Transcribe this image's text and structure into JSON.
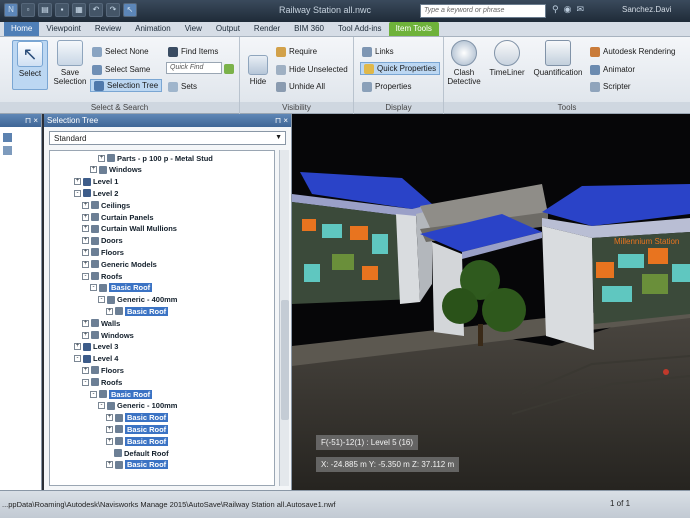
{
  "window": {
    "title": "Railway Station all.nwc",
    "search_placeholder": "Type a keyword or phrase",
    "user": "Sanchez.Davi"
  },
  "ribbon_tabs": [
    "Home",
    "Viewpoint",
    "Review",
    "Animation",
    "View",
    "Output",
    "Render",
    "BIM 360",
    "Tool Add-ins",
    "Item Tools"
  ],
  "ribbon": {
    "select_search": {
      "label": "Select & Search",
      "select": "Select",
      "save_selection": "Save Selection",
      "select_none": "Select None",
      "select_same": "Select Same",
      "selection_tree": "Selection Tree",
      "find_items": "Find Items",
      "quick_find_placeholder": "Quick Find",
      "sets": "Sets"
    },
    "visibility": {
      "label": "Visibility",
      "hide": "Hide",
      "require": "Require",
      "hide_unselected": "Hide Unselected",
      "unhide_all": "Unhide All"
    },
    "display": {
      "label": "Display",
      "links": "Links",
      "quick_properties": "Quick Properties",
      "properties": "Properties"
    },
    "tools": {
      "label": "Tools",
      "clash_detective": "Clash Detective",
      "timeliner": "TimeLiner",
      "quantification": "Quantification",
      "autodesk_rendering": "Autodesk Rendering",
      "animator": "Animator",
      "scripter": "Scripter"
    }
  },
  "selection_tree": {
    "title": "Selection Tree",
    "dropdown_value": "Standard",
    "rows": [
      {
        "label": "Parts - p 100 p - Metal Stud",
        "indent": 5,
        "exp": "+",
        "hl": false
      },
      {
        "label": "Windows",
        "indent": 4,
        "exp": "+",
        "hl": false
      },
      {
        "label": "Level 1",
        "indent": 2,
        "exp": "+",
        "hl": false
      },
      {
        "label": "Level 2",
        "indent": 2,
        "exp": "-",
        "hl": false
      },
      {
        "label": "Ceilings",
        "indent": 3,
        "exp": "+",
        "hl": false
      },
      {
        "label": "Curtain Panels",
        "indent": 3,
        "exp": "+",
        "hl": false
      },
      {
        "label": "Curtain Wall Mullions",
        "indent": 3,
        "exp": "+",
        "hl": false
      },
      {
        "label": "Doors",
        "indent": 3,
        "exp": "+",
        "hl": false
      },
      {
        "label": "Floors",
        "indent": 3,
        "exp": "+",
        "hl": false
      },
      {
        "label": "Generic Models",
        "indent": 3,
        "exp": "+",
        "hl": false
      },
      {
        "label": "Roofs",
        "indent": 3,
        "exp": "-",
        "hl": false
      },
      {
        "label": "Basic Roof",
        "indent": 4,
        "exp": "-",
        "hl": true
      },
      {
        "label": "Generic - 400mm",
        "indent": 5,
        "exp": "-",
        "hl": false
      },
      {
        "label": "Basic Roof",
        "indent": 6,
        "exp": "+",
        "hl": true
      },
      {
        "label": "Walls",
        "indent": 3,
        "exp": "+",
        "hl": false
      },
      {
        "label": "Windows",
        "indent": 3,
        "exp": "+",
        "hl": false
      },
      {
        "label": "Level 3",
        "indent": 2,
        "exp": "+",
        "hl": false
      },
      {
        "label": "Level 4",
        "indent": 2,
        "exp": "-",
        "hl": false
      },
      {
        "label": "Floors",
        "indent": 3,
        "exp": "+",
        "hl": false
      },
      {
        "label": "Roofs",
        "indent": 3,
        "exp": "-",
        "hl": false
      },
      {
        "label": "Basic Roof",
        "indent": 4,
        "exp": "-",
        "hl": true
      },
      {
        "label": "Generic - 100mm",
        "indent": 5,
        "exp": "-",
        "hl": false
      },
      {
        "label": "Basic Roof",
        "indent": 6,
        "exp": "+",
        "hl": true
      },
      {
        "label": "Basic Roof",
        "indent": 6,
        "exp": "+",
        "hl": true
      },
      {
        "label": "Basic Roof",
        "indent": 6,
        "exp": "+",
        "hl": true
      },
      {
        "label": "Default Roof",
        "indent": 7,
        "exp": "",
        "hl": false
      },
      {
        "label": "Basic Roof",
        "indent": 6,
        "exp": "+",
        "hl": true
      }
    ]
  },
  "viewport": {
    "sign_text": "Millennium Station",
    "hud_level": "F(-51)-12(1) : Level 5 (16)",
    "hud_coords": "X: -24.885 m  Y: -5.350 m  Z: 37.112 m"
  },
  "statusbar": {
    "path": "...ppData\\Roaming\\Autodesk\\Navisworks Manage 2015\\AutoSave\\Railway Station all.Autosave1.nwf",
    "page": "1 of 1"
  },
  "colors": {
    "accent_blue": "#3b73c4",
    "item_tools_green": "#6eb23a",
    "roof_blue": "#2a43c8",
    "panel_orange": "#e8741f",
    "panel_teal": "#5fc7c0"
  }
}
